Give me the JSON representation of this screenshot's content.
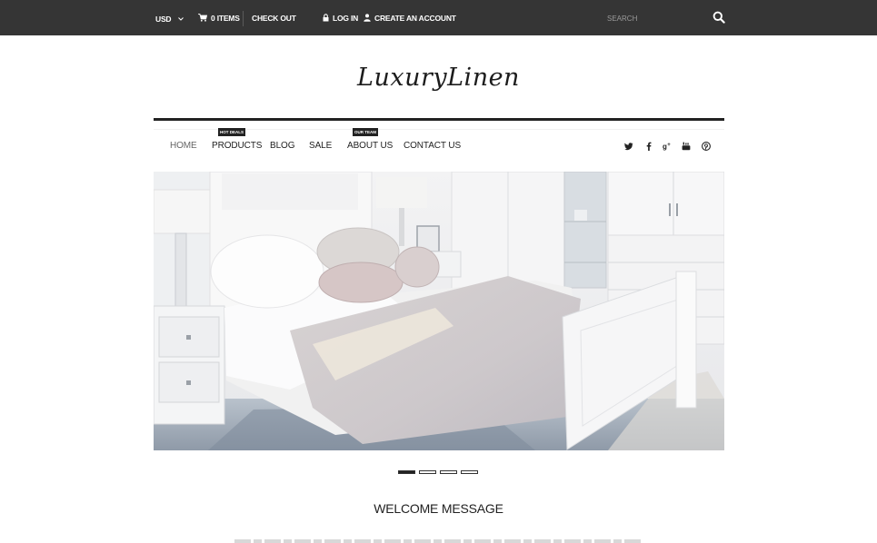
{
  "topbar": {
    "currency": "USD",
    "cart_items": "0 ITEMS",
    "checkout": "CHECK OUT",
    "login": "LOG IN",
    "create_account": "CREATE AN ACCOUNT",
    "search_placeholder": "SEARCH"
  },
  "logo": {
    "text": "LuxuryLinen"
  },
  "nav": {
    "items": [
      {
        "label": "HOME"
      },
      {
        "label": "PRODUCTS",
        "badge": "HOT DEALS"
      },
      {
        "label": "BLOG"
      },
      {
        "label": "SALE"
      },
      {
        "label": "ABOUT US",
        "badge": "OUR TEAM"
      },
      {
        "label": "CONTACT US"
      }
    ],
    "social": [
      "twitter-icon",
      "facebook-icon",
      "google-plus-icon",
      "youtube-icon",
      "pinterest-icon"
    ]
  },
  "hero": {
    "alt": "White bedroom with bed, pillows, nightstands and wardrobe"
  },
  "slider": {
    "slides": 4,
    "active": 1
  },
  "welcome": {
    "title": "WELCOME MESSAGE"
  },
  "colors": {
    "topbar": "#353535",
    "text": "#222222",
    "background": "#ffffff"
  }
}
